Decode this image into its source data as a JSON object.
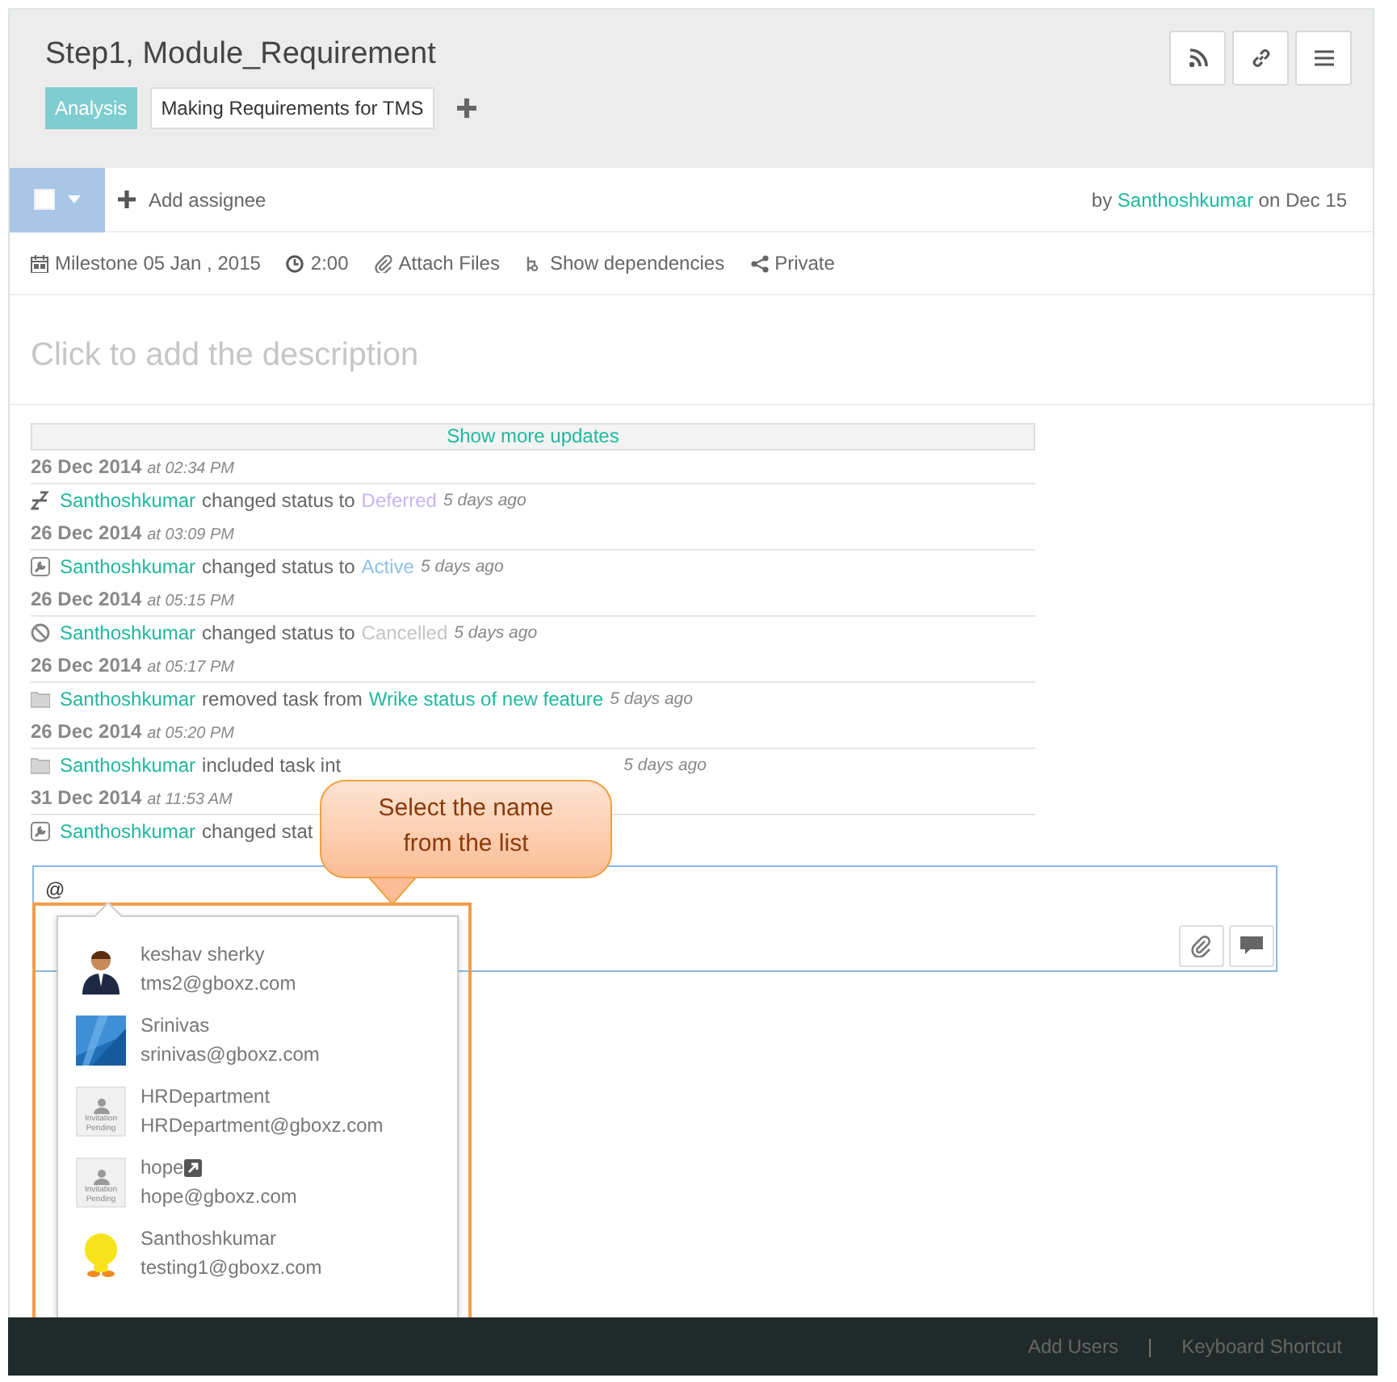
{
  "task": {
    "title": "Step1, Module_Requirement",
    "tags": [
      {
        "label": "Analysis",
        "kind": "status"
      },
      {
        "label": "Making Requirements for TMS",
        "kind": "folder"
      }
    ]
  },
  "assignee": {
    "checked": false,
    "label": "Add assignee"
  },
  "author": {
    "prefix": "by",
    "name": "Santhoshkumar",
    "suffix": "on Dec 15"
  },
  "meta": [
    {
      "kind": "calendar",
      "label": "Milestone 05 Jan , 2015"
    },
    {
      "kind": "clock",
      "label": "2:00"
    },
    {
      "kind": "attach",
      "label": "Attach Files"
    },
    {
      "kind": "dependencies",
      "label": "Show dependencies"
    },
    {
      "kind": "share",
      "label": "Private"
    }
  ],
  "description": {
    "placeholder": "Click to add the description"
  },
  "show_more": "Show more updates",
  "updates": [
    {
      "date": "26 Dec 2014",
      "time": "at 02:34 PM",
      "kind": "sleep",
      "actor": "Santhoshkumar",
      "action": "changed status to",
      "target": "Deferred",
      "color": "#c9b6f2",
      "ago": "5 days ago"
    },
    {
      "date": "26 Dec 2014",
      "time": "at 03:09 PM",
      "kind": "wrench",
      "actor": "Santhoshkumar",
      "action": "changed status to",
      "target": "Active",
      "color": "#8fc1e6",
      "ago": "5 days ago"
    },
    {
      "date": "26 Dec 2014",
      "time": "at 05:15 PM",
      "kind": "cancel",
      "actor": "Santhoshkumar",
      "action": "changed status to",
      "target": "Cancelled",
      "color": "#c4c4c4",
      "ago": "5 days ago"
    },
    {
      "date": "26 Dec 2014",
      "time": "at 05:17 PM",
      "kind": "folder",
      "actor": "Santhoshkumar",
      "action": "removed task from",
      "target": "Wrike status of new feature",
      "color": "#1fb89e",
      "ago": "5 days ago"
    },
    {
      "date": "26 Dec 2014",
      "time": "at 05:20 PM",
      "kind": "folder",
      "actor": "Santhoshkumar",
      "action": "included task int",
      "ago": "5 days ago"
    },
    {
      "date": "31 Dec 2014",
      "time": "at 11:53 AM",
      "kind": "wrench",
      "actor": "Santhoshkumar",
      "action": "changed stat"
    }
  ],
  "comment": {
    "value": "@"
  },
  "mentions": [
    {
      "name": "keshav sherky",
      "email": "tms2@gboxz.com",
      "kind": "person",
      "external": false
    },
    {
      "name": "Srinivas",
      "email": "srinivas@gboxz.com",
      "kind": "picture",
      "external": false
    },
    {
      "name": "HRDepartment",
      "email": "HRDepartment@gboxz.com",
      "kind": "pending",
      "avatar_text": [
        "Invitation",
        "Pending"
      ],
      "external": false
    },
    {
      "name": "hope",
      "email": "hope@gboxz.com",
      "kind": "pending",
      "avatar_text": [
        "Invitation",
        "Pending"
      ],
      "external": true
    },
    {
      "name": "Santhoshkumar",
      "email": "testing1@gboxz.com",
      "kind": "bird",
      "external": false
    }
  ],
  "callout": {
    "text": "Select the name from the list"
  },
  "footer": {
    "links": [
      "Add Users",
      "Keyboard Shortcut"
    ],
    "separator": "|"
  }
}
